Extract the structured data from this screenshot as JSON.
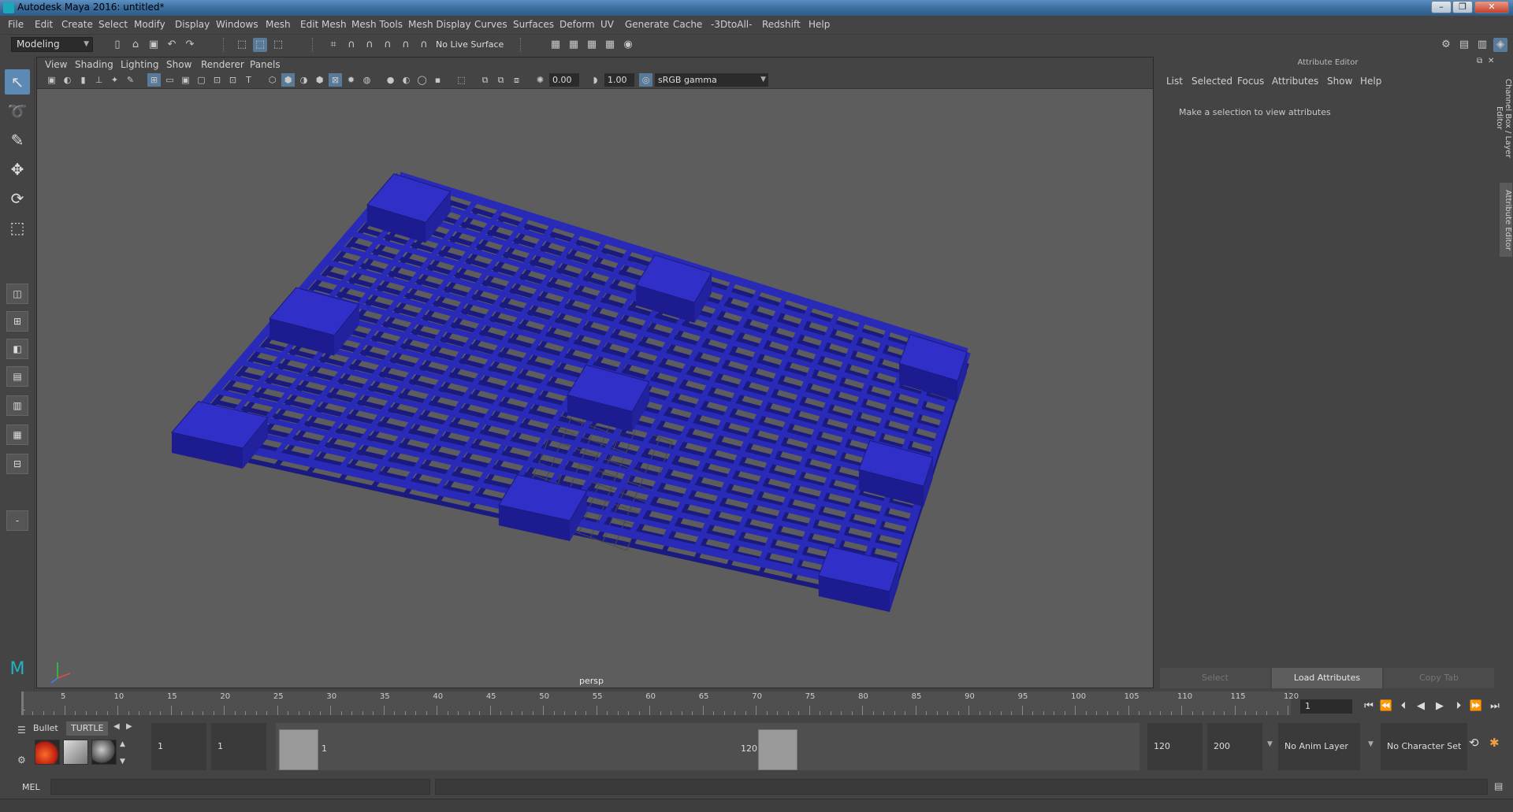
{
  "window": {
    "title": "Autodesk Maya 2016: untitled*",
    "minimize": "–",
    "restore": "❐",
    "close": "✕"
  },
  "menubar": [
    "File",
    "Edit",
    "Create",
    "Select",
    "Modify",
    "Display",
    "Windows",
    "Mesh",
    "Edit Mesh",
    "Mesh Tools",
    "Mesh Display",
    "Curves",
    "Surfaces",
    "Deform",
    "UV",
    "Generate",
    "Cache",
    "-3DtoAll-",
    "Redshift",
    "Help"
  ],
  "status_toolbar": {
    "mode": "Modeling",
    "live_surface": "No Live Surface"
  },
  "viewport": {
    "menu": [
      "View",
      "Shading",
      "Lighting",
      "Show",
      "Renderer",
      "Panels"
    ],
    "exposure": "0.00",
    "gamma": "1.00",
    "color_management": "sRGB gamma",
    "camera": "persp",
    "model_color": "#2a2ab8"
  },
  "attribute_editor": {
    "title": "Attribute Editor",
    "menu": [
      "List",
      "Selected",
      "Focus",
      "Attributes",
      "Show",
      "Help"
    ],
    "message": "Make a selection to view attributes",
    "buttons": {
      "select": "Select",
      "load": "Load Attributes",
      "copy": "Copy Tab"
    }
  },
  "side_tabs": [
    "Channel Box / Layer Editor",
    "Attribute Editor"
  ],
  "timeline": {
    "start_label": "1",
    "ticks": [
      "5",
      "10",
      "15",
      "20",
      "25",
      "30",
      "35",
      "40",
      "45",
      "50",
      "55",
      "60",
      "65",
      "70",
      "75",
      "80",
      "85",
      "90",
      "95",
      "100",
      "105",
      "110",
      "115",
      "120"
    ],
    "current_frame": "1"
  },
  "shelf": {
    "tabs": [
      "Bullet",
      "TURTLE"
    ]
  },
  "range": {
    "start_field": "1",
    "inner_start_field": "1",
    "range_start_label": "1",
    "range_end_label": "120",
    "end_field": "120",
    "outer_end_field": "200",
    "anim_layer": "No Anim Layer",
    "character_set": "No Character Set"
  },
  "command_line": {
    "label": "MEL"
  }
}
